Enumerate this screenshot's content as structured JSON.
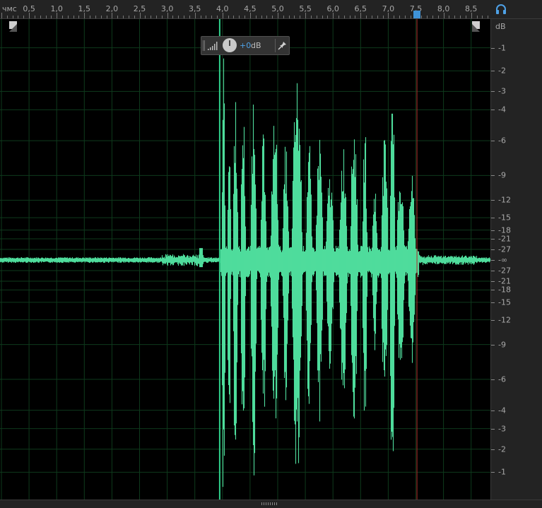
{
  "time_ruler": {
    "unit": "чмс",
    "labels": [
      "0,5",
      "1,0",
      "1,5",
      "2,0",
      "2,5",
      "3,0",
      "3,5",
      "4,0",
      "4,5",
      "5,0",
      "5,5",
      "6,0",
      "6,5",
      "7,0",
      "7,5",
      "8,0",
      "8,5"
    ],
    "label_values": [
      0.5,
      1.0,
      1.5,
      2.0,
      2.5,
      3.0,
      3.5,
      4.0,
      4.5,
      5.0,
      5.5,
      6.0,
      6.5,
      7.0,
      7.5,
      8.0,
      8.5
    ]
  },
  "amplitude_ruler": {
    "unit": "dB",
    "upper_labels": [
      "-1",
      "-2",
      "-3",
      "-4",
      "-6",
      "-9",
      "-12",
      "-15",
      "-18",
      "-21",
      "-27"
    ],
    "center_label": "-∞",
    "lower_labels": [
      "-27",
      "-21",
      "-18",
      "-15",
      "-12",
      "-9",
      "-6",
      "-4",
      "-3",
      "-2",
      "-1"
    ],
    "db_values": [
      -1,
      -2,
      -3,
      -4,
      -6,
      -9,
      -12,
      -15,
      -18,
      -21,
      -27
    ]
  },
  "hud": {
    "gain_value": "+0",
    "gain_unit": "dB"
  },
  "playhead_time": 3.95,
  "selection_end_time": 7.52,
  "colors": {
    "waveform": "#4fdc9c",
    "grid": "#0e3a1c",
    "playhead": "#2fcf8a",
    "cursor_line": "#b02a2a",
    "accent": "#4ea1e6"
  },
  "icons": {
    "zoom_in": "zoom-in-corner-icon",
    "zoom_out": "zoom-out-corner-icon",
    "headphones": "headphones-icon",
    "pin": "pin-icon",
    "level": "level-meter-icon"
  }
}
